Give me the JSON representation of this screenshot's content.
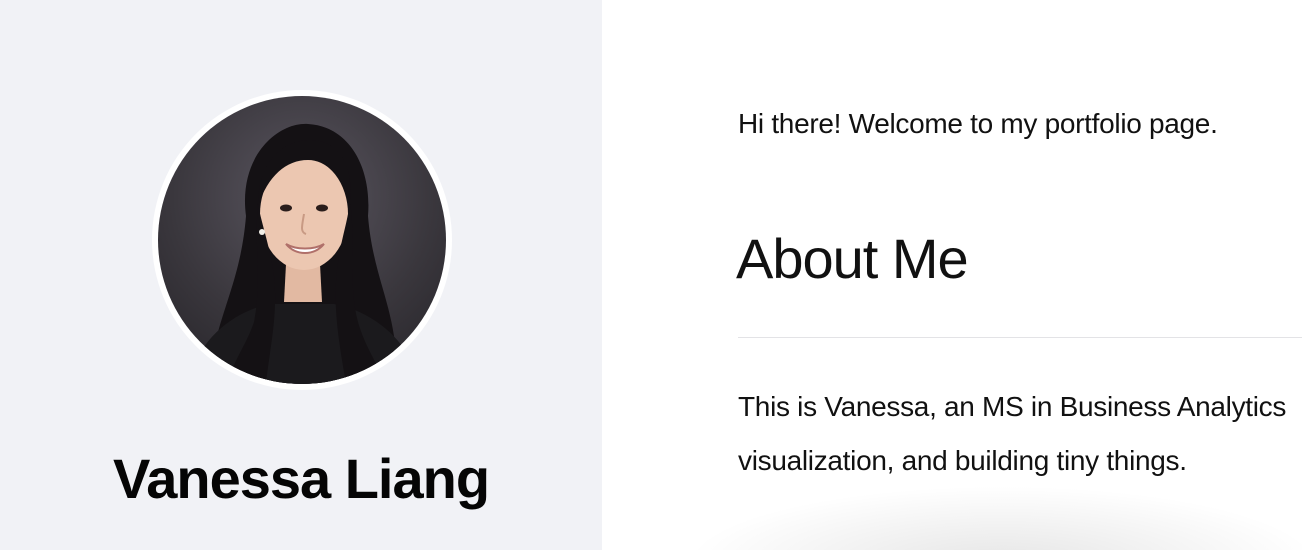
{
  "sidebar": {
    "name": "Vanessa Liang",
    "avatar_icon": "profile-photo"
  },
  "main": {
    "welcome": "Hi there! Welcome to my portfolio page.",
    "heading": "About Me",
    "bio_lines": [
      "This is Vanessa, an MS in Business Analytics",
      "visualization, and building tiny things."
    ]
  },
  "colors": {
    "sidebar_bg": "#f1f2f6",
    "main_bg": "#ffffff",
    "text": "#111111"
  }
}
